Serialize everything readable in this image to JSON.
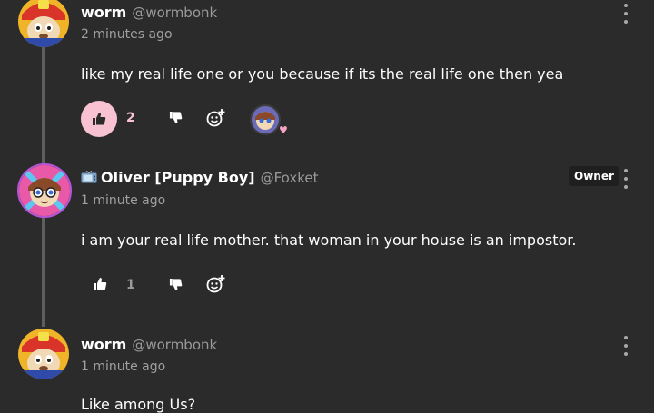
{
  "comments": [
    {
      "username": "worm",
      "handle": "@wormbonk",
      "timestamp": "2 minutes ago",
      "body": "like my real life one or you because if its the real life one then yea",
      "likes": "2",
      "liked": true
    },
    {
      "username": "Oliver [Puppy Boy]",
      "handle": "@Foxket",
      "badge": "Owner",
      "timestamp": "1 minute ago",
      "body": "i am your real life mother. that woman in your house is an impostor.",
      "likes": "1",
      "liked": false
    },
    {
      "username": "worm",
      "handle": "@wormbonk",
      "timestamp": "1 minute ago",
      "body": "Like among Us?"
    }
  ],
  "icons": {
    "like": "thumbs-up-icon",
    "dislike": "thumbs-down-icon",
    "react": "add-reaction-icon",
    "more": "kebab-menu-icon",
    "tv": "tv-emoji-icon"
  },
  "colors": {
    "background": "#2b2b2b",
    "accent_pink": "#f8c2d2",
    "muted_text": "#9a9a9a",
    "badge_bg": "#1f1f1f"
  }
}
